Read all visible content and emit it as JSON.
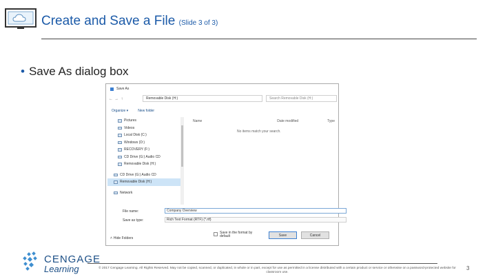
{
  "slide": {
    "title": "Create and Save a File",
    "subtitle": "(Slide 3 of 3)",
    "bullet": "Save As dialog box",
    "slide_number": "3"
  },
  "dialog": {
    "title": "Save As",
    "address": "Removable Disk (H:)",
    "search_placeholder": "Search Removable Disk (H:)",
    "toolbar": {
      "organize": "Organize ▾",
      "new_folder": "New folder"
    },
    "nav_items": [
      {
        "label": "Pictures"
      },
      {
        "label": "Videos"
      },
      {
        "label": "Local Disk (C:)"
      },
      {
        "label": "Windows (D:)"
      },
      {
        "label": "RECOVERY (F:)"
      },
      {
        "label": "CD Drive (G:) Audio CD"
      },
      {
        "label": "Removable Disk (H:)"
      },
      {
        "label": "CD Drive (G:) Audio CD"
      },
      {
        "label": "Removable Disk (H:)"
      },
      {
        "label": "Network"
      }
    ],
    "columns": [
      "Name",
      "Date modified",
      "Type"
    ],
    "empty_message": "No items match your search.",
    "file_name_label": "File name:",
    "file_name_value": "Company Overview",
    "save_type_label": "Save as type:",
    "save_type_value": "Rich Text Format (RTF) (*.rtf)",
    "thumbnail_label": "Save in the format by default",
    "hide_folders": "Hide Folders",
    "save_button": "Save",
    "cancel_button": "Cancel"
  },
  "footer": {
    "brand_top": "CENGAGE",
    "brand_bottom": "Learning",
    "copyright": "© 2017 Cengage Learning. All Rights Reserved. May not be copied, scanned, or duplicated, in whole or in part, except for use as permitted in a license distributed with a certain product or service or otherwise on a password-protected website for classroom use."
  },
  "colors": {
    "title": "#1b5aa8",
    "brand": "#1c4f86",
    "accent": "#3c7fd1"
  }
}
